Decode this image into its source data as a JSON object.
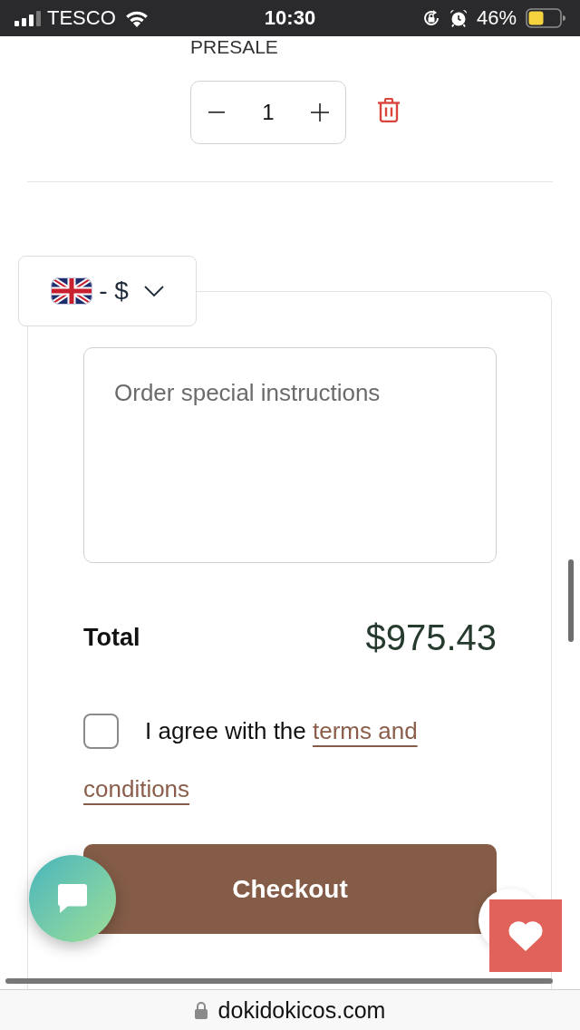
{
  "status_bar": {
    "carrier": "TESCO",
    "time": "10:30",
    "battery": "46%"
  },
  "cart_item": {
    "tag": "PRESALE",
    "quantity": "1"
  },
  "currency_selector": {
    "label": "- $"
  },
  "notes": {
    "placeholder": "Order special instructions"
  },
  "total": {
    "label": "Total",
    "amount": "$975.43"
  },
  "agreement": {
    "checked": false,
    "text": "I agree with the",
    "link": "terms and conditions"
  },
  "checkout_button": {
    "label": "Checkout"
  },
  "browser_bar": {
    "url": "dokidokicos.com"
  }
}
